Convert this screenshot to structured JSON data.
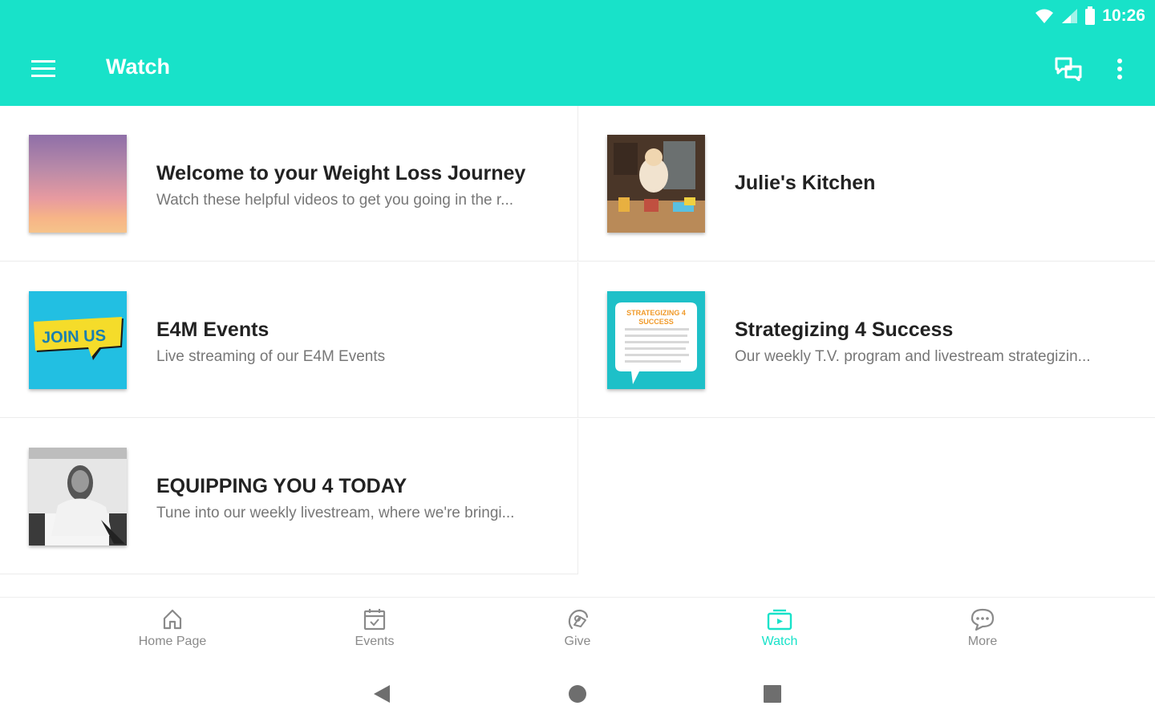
{
  "status_bar": {
    "time": "10:26"
  },
  "app_bar": {
    "title": "Watch"
  },
  "colors": {
    "accent": "#18e2c9",
    "title_text": "#222222",
    "subtitle_text": "#777777",
    "inactive_nav": "#8a8a8a"
  },
  "items": [
    {
      "title": "Welcome to your Weight Loss Journey",
      "subtitle": "Watch these helpful videos to get you going in the r..."
    },
    {
      "title": "Julie's Kitchen",
      "subtitle": ""
    },
    {
      "title": "E4M  Events",
      "subtitle": "Live streaming of our E4M Events"
    },
    {
      "title": "Strategizing 4 Success",
      "subtitle": "Our weekly T.V. program and livestream strategizin..."
    },
    {
      "title": "EQUIPPING YOU 4 TODAY",
      "subtitle": "Tune into our weekly livestream, where we're bringi..."
    }
  ],
  "thumbs": {
    "join_us_text": "JOIN US",
    "strategizing_text": "STRATEGIZING 4 SUCCESS"
  },
  "bottom_nav": [
    {
      "label": "Home Page",
      "icon": "home-icon"
    },
    {
      "label": "Events",
      "icon": "calendar-icon"
    },
    {
      "label": "Give",
      "icon": "give-icon"
    },
    {
      "label": "Watch",
      "icon": "tv-icon",
      "active": true
    },
    {
      "label": "More",
      "icon": "chat-bubble-icon"
    }
  ]
}
